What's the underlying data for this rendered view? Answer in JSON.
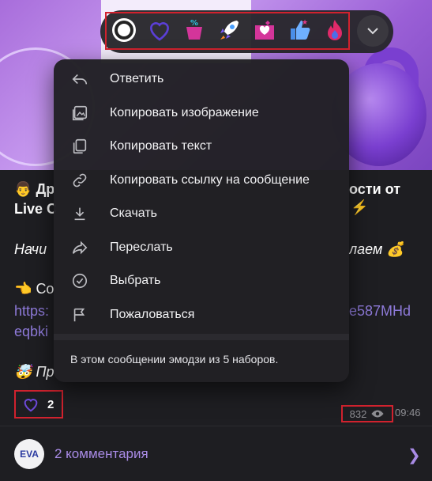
{
  "post": {
    "line1_left": "Др",
    "line1_right": "ости от",
    "line2_left": "Live C",
    "line3_left": "Начи",
    "line3_right": "лаем",
    "line4_left": "Со",
    "link_left": "https:",
    "link_right": "e587MHd",
    "line6_left": "eqbki",
    "line7_left": "Пр",
    "reaction_count": "2",
    "views": "832",
    "time": "09:46"
  },
  "comments": {
    "avatar_text": "EVA",
    "label": "2 комментария"
  },
  "reactions": [
    "dark-badge-emoji",
    "purple-heart-emoji",
    "percent-basket-emoji",
    "rocket-emoji",
    "heart-mail-emoji",
    "thumbs-up-emoji",
    "fire-emoji"
  ],
  "menu": {
    "items": [
      {
        "label": "Ответить",
        "icon": "reply-icon"
      },
      {
        "label": "Копировать изображение",
        "icon": "copy-image-icon"
      },
      {
        "label": "Копировать текст",
        "icon": "copy-text-icon"
      },
      {
        "label": "Копировать ссылку на сообщение",
        "icon": "link-icon"
      },
      {
        "label": "Скачать",
        "icon": "download-icon"
      },
      {
        "label": "Переслать",
        "icon": "forward-icon"
      },
      {
        "label": "Выбрать",
        "icon": "select-check-icon"
      },
      {
        "label": "Пожаловаться",
        "icon": "flag-icon"
      }
    ],
    "note": "В этом сообщении эмодзи из 5 наборов."
  },
  "colors": {
    "accent": "#a98be6",
    "link": "#8e7ad9",
    "highlight": "#d1222e",
    "menu_bg": "#212024"
  }
}
